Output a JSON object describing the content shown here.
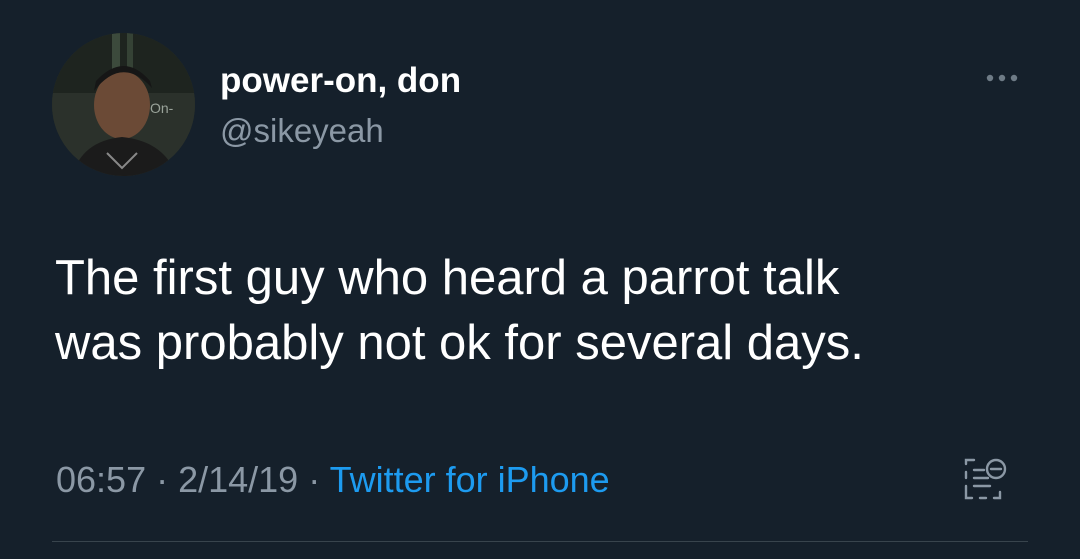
{
  "user": {
    "display_name": "power-on, don",
    "handle": "@sikeyeah",
    "avatar_icon": "profile-photo"
  },
  "tweet": {
    "lines": [
      "The first guy who heard a parrot talk",
      "was probably not ok for several days."
    ]
  },
  "meta": {
    "time": "06:57",
    "separator": " · ",
    "date": "2/14/19",
    "source": "Twitter for iPhone"
  },
  "icons": {
    "more": "more-horizontal-icon",
    "analytics": "analytics-icon"
  },
  "colors": {
    "background": "#15202b",
    "text": "#ffffff",
    "secondary_text": "#8b98a5",
    "link": "#1d9bf0"
  }
}
